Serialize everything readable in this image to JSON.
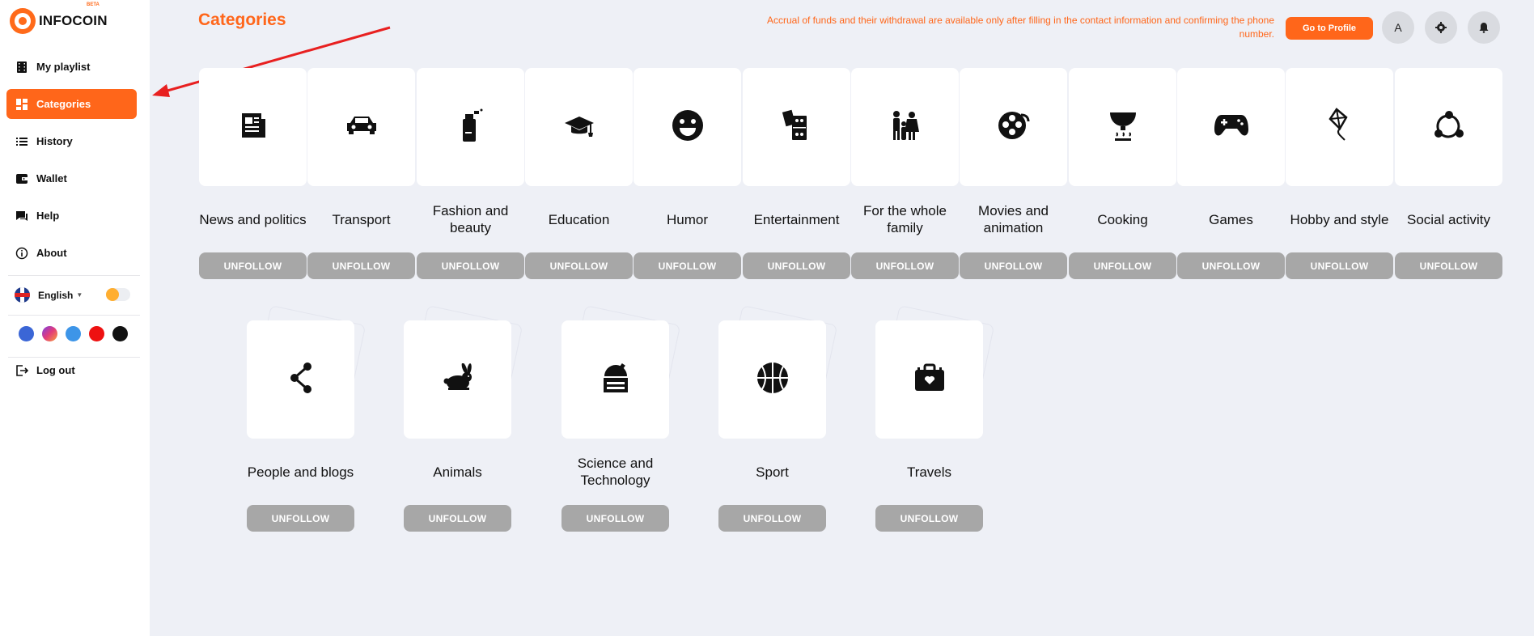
{
  "sidebar": {
    "logo_text": "INFOCOIN",
    "logo_badge": "BETA",
    "items": [
      {
        "label": "My playlist",
        "icon": "film-icon"
      },
      {
        "label": "Categories",
        "icon": "grid-icon"
      },
      {
        "label": "History",
        "icon": "list-icon"
      },
      {
        "label": "Wallet",
        "icon": "wallet-icon"
      },
      {
        "label": "Help",
        "icon": "chat-icon"
      },
      {
        "label": "About",
        "icon": "info-icon"
      }
    ],
    "language": "English",
    "logout": "Log out",
    "social": [
      "facebook-icon",
      "instagram-icon",
      "twitter-icon",
      "youtube-icon",
      "tiktok-icon"
    ],
    "accent": "#ff661a"
  },
  "header": {
    "title": "Categories",
    "notice": "Accrual of funds and their withdrawal are available only after filling in the contact information and confirming the phone number.",
    "profile_button": "Go to Profile",
    "avatar_letter": "A"
  },
  "categories": [
    {
      "label": "News and politics",
      "icon": "newspaper-icon",
      "button": "UNFOLLOW"
    },
    {
      "label": "Transport",
      "icon": "car-icon",
      "button": "UNFOLLOW"
    },
    {
      "label": "Fashion and beauty",
      "icon": "perfume-icon",
      "button": "UNFOLLOW"
    },
    {
      "label": "Education",
      "icon": "graduation-cap-icon",
      "button": "UNFOLLOW"
    },
    {
      "label": "Humor",
      "icon": "smile-icon",
      "button": "UNFOLLOW"
    },
    {
      "label": "Entertainment",
      "icon": "dice-cards-icon",
      "button": "UNFOLLOW"
    },
    {
      "label": "For the whole family",
      "icon": "family-icon",
      "button": "UNFOLLOW"
    },
    {
      "label": "Movies and animation",
      "icon": "film-reel-icon",
      "button": "UNFOLLOW"
    },
    {
      "label": "Cooking",
      "icon": "cooking-pot-icon",
      "button": "UNFOLLOW"
    },
    {
      "label": "Games",
      "icon": "gamepad-icon",
      "button": "UNFOLLOW"
    },
    {
      "label": "Hobby and style",
      "icon": "kite-icon",
      "button": "UNFOLLOW"
    },
    {
      "label": "Social activity",
      "icon": "network-icon",
      "button": "UNFOLLOW"
    },
    {
      "label": "People and blogs",
      "icon": "share-icon",
      "button": "UNFOLLOW"
    },
    {
      "label": "Animals",
      "icon": "rabbit-icon",
      "button": "UNFOLLOW"
    },
    {
      "label": "Science and Technology",
      "icon": "observatory-icon",
      "button": "UNFOLLOW"
    },
    {
      "label": "Sport",
      "icon": "basketball-icon",
      "button": "UNFOLLOW"
    },
    {
      "label": "Travels",
      "icon": "suitcase-icon",
      "button": "UNFOLLOW"
    }
  ]
}
